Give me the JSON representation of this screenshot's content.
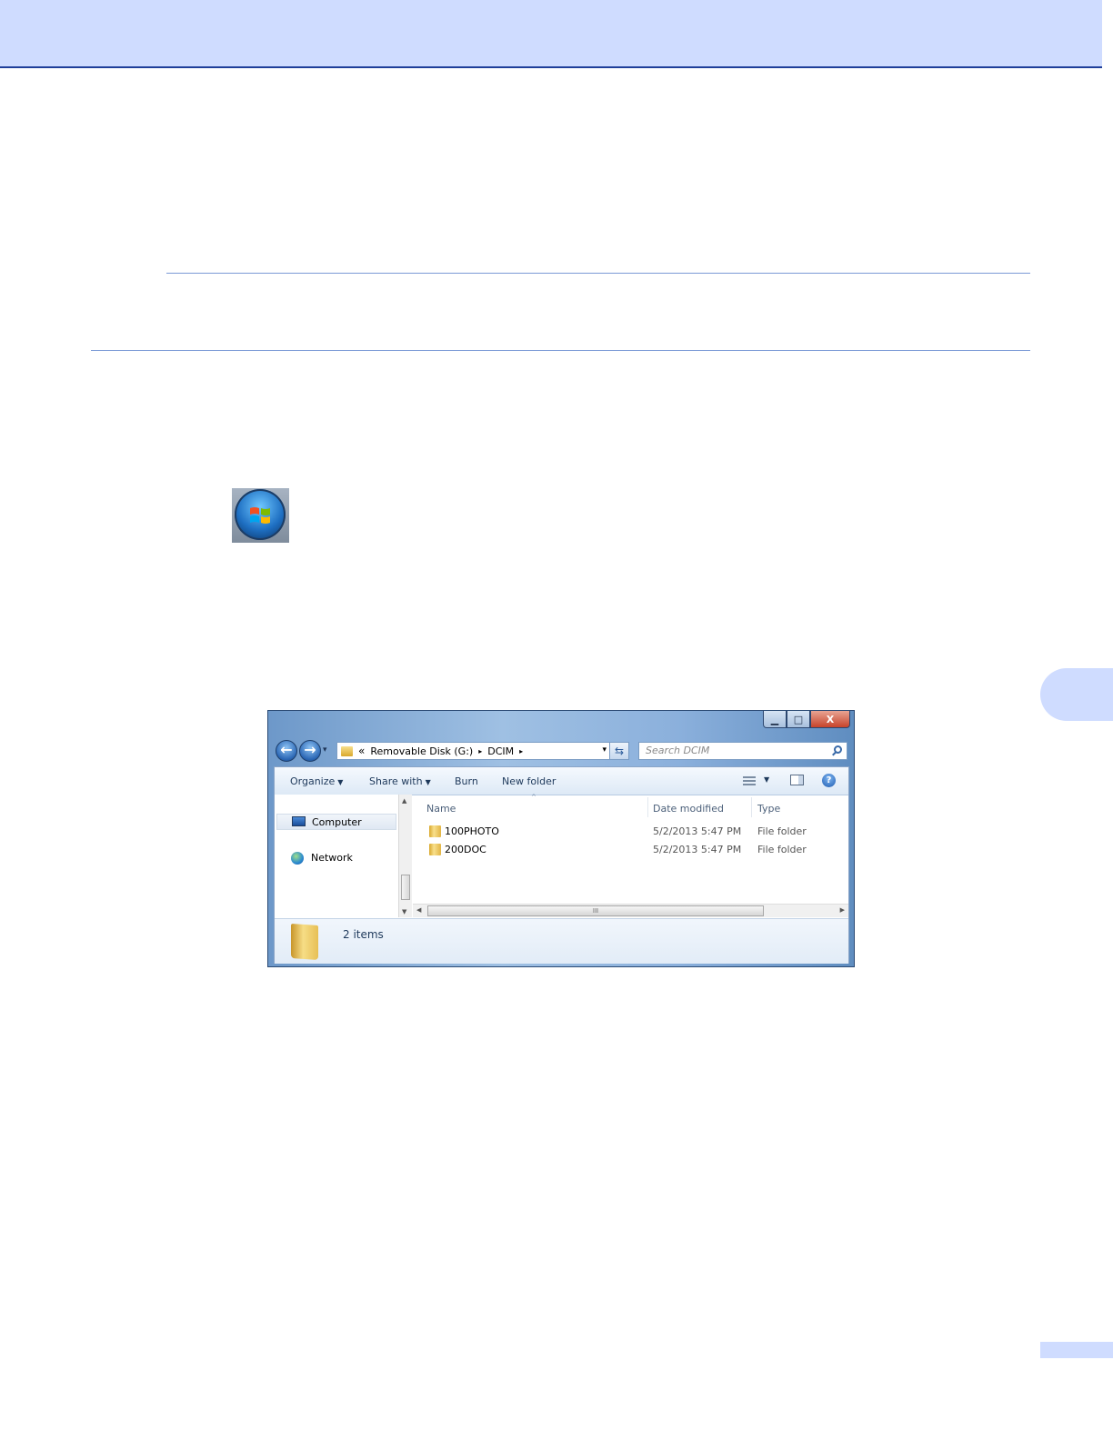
{
  "explorer": {
    "window_controls": {
      "minimize": "▁",
      "maximize": "□",
      "close": "X"
    },
    "nav": {
      "back_icon": "←",
      "forward_icon": "→",
      "recent_icon": "▾"
    },
    "address": {
      "overflow": "«",
      "segments": [
        "Removable Disk (G:)",
        "DCIM"
      ],
      "separator": "▸",
      "dropdown": "▾"
    },
    "refresh_icon": "⇆",
    "search_placeholder": "Search DCIM",
    "toolbar": {
      "organize": "Organize",
      "share_with": "Share with",
      "burn": "Burn",
      "new_folder": "New folder",
      "caret": "▼",
      "views_drop": "▼",
      "help": "?"
    },
    "nav_pane": {
      "computer": "Computer",
      "network": "Network"
    },
    "columns": {
      "name": "Name",
      "date": "Date modified",
      "type": "Type",
      "sort_indicator": "^"
    },
    "files": [
      {
        "name": "100PHOTO",
        "date": "5/2/2013 5:47 PM",
        "type": "File folder"
      },
      {
        "name": "200DOC",
        "date": "5/2/2013 5:47 PM",
        "type": "File folder"
      }
    ],
    "scroll": {
      "up": "▲",
      "down": "▼",
      "left": "◀",
      "right": "▶",
      "grip": "III"
    },
    "status": {
      "item_count": "2 items"
    }
  }
}
